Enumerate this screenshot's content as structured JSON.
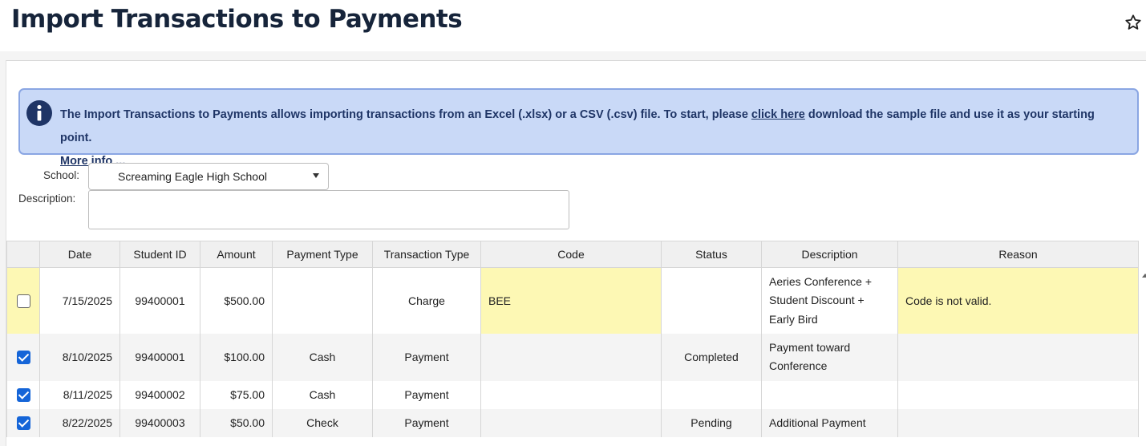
{
  "header": {
    "title": "Import Transactions to Payments",
    "star_icon": "star-outline-icon"
  },
  "info": {
    "icon": "info-circle-icon",
    "text_before": "The Import Transactions to Payments allows importing transactions from an Excel (.xlsx) or a CSV (.csv) file. To start, please ",
    "link_text": "click here",
    "text_after": " download the sample file and use it as your starting point.",
    "more_info": "More info ...",
    "color_bg": "#c9d9f7",
    "color_border": "#8aa6e3"
  },
  "form": {
    "school_label": "School:",
    "school_value": "Screaming Eagle High School",
    "description_label": "Description:",
    "description_value": ""
  },
  "table": {
    "headers": [
      "",
      "Date",
      "Student ID",
      "Amount",
      "Payment Type",
      "Transaction Type",
      "Code",
      "Status",
      "Description",
      "Reason"
    ],
    "rows": [
      {
        "checked": false,
        "date": "7/15/2025",
        "student_id": "99400001",
        "amount": "$500.00",
        "payment_type": "",
        "transaction_type": "Charge",
        "code": "BEE",
        "status": "",
        "description_lines": [
          "Aeries Conference +",
          "Student Discount +",
          "Early Bird"
        ],
        "reason": "Code is not valid."
      },
      {
        "checked": true,
        "date": "8/10/2025",
        "student_id": "99400001",
        "amount": "$100.00",
        "payment_type": "Cash",
        "transaction_type": "Payment",
        "code": "",
        "status": "Completed",
        "description_lines": [
          "Payment toward",
          "Conference"
        ],
        "reason": ""
      },
      {
        "checked": true,
        "date": "8/11/2025",
        "student_id": "99400002",
        "amount": "$75.00",
        "payment_type": "Cash",
        "transaction_type": "Payment",
        "code": "",
        "status": "",
        "description_lines": [
          ""
        ],
        "reason": ""
      },
      {
        "checked": true,
        "date": "8/22/2025",
        "student_id": "99400003",
        "amount": "$50.00",
        "payment_type": "Check",
        "transaction_type": "Payment",
        "code": "",
        "status": "Pending",
        "description_lines": [
          "Additional Payment"
        ],
        "reason": ""
      }
    ],
    "error_highlight_color": "#fdf8b4",
    "checkbox_color": "#1565d8"
  }
}
